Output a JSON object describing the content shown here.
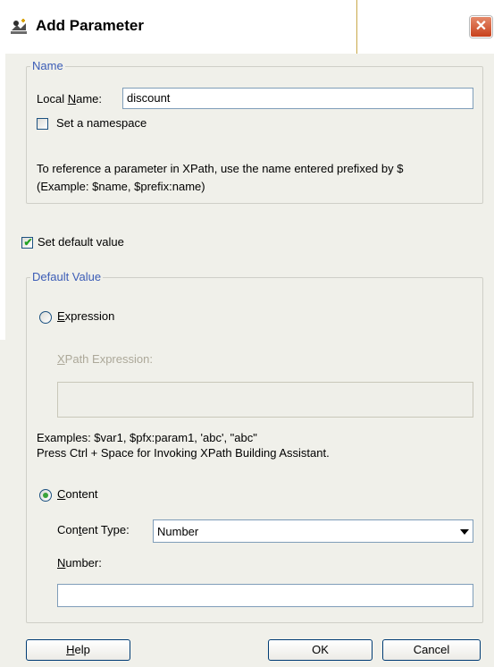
{
  "window": {
    "title": "Add Parameter",
    "close_glyph": "✕"
  },
  "name_group": {
    "legend": "Name",
    "local_name_label_prefix": "Local ",
    "local_name_label_key": "N",
    "local_name_label_suffix": "ame:",
    "local_name_value": "discount",
    "namespace_checkbox_label": "Set a namespace",
    "namespace_checked": false,
    "hint_line1": "To reference a parameter in XPath, use the name entered prefixed by $",
    "hint_line2": "(Example: $name, $prefix:name)"
  },
  "default_checkbox": {
    "label": "Set default value",
    "checked": true
  },
  "default_group": {
    "legend": "Default Value",
    "expression_radio_key": "E",
    "expression_radio_rest": "xpression",
    "expression_selected": false,
    "xpath_label_key": "X",
    "xpath_label_rest": "Path Expression:",
    "xpath_value": "",
    "examples_line1": "Examples: $var1, $pfx:param1, 'abc', \"abc\"",
    "examples_line2": "Press Ctrl + Space for Invoking XPath Building Assistant.",
    "content_radio_key": "C",
    "content_radio_rest": "ontent",
    "content_selected": true,
    "content_type_label_prefix": "Con",
    "content_type_label_key": "t",
    "content_type_label_suffix": "ent Type:",
    "content_type_value": "Number",
    "number_label_key": "N",
    "number_label_rest": "umber:",
    "number_value": ""
  },
  "buttons": {
    "help_key": "H",
    "help_rest": "elp",
    "ok": "OK",
    "cancel": "Cancel"
  },
  "icons": {
    "title_icon": "add-parameter-icon",
    "close_icon": "close-icon",
    "dropdown_icon": "chevron-down-icon"
  },
  "colors": {
    "legend_blue": "#3b5cb6",
    "close_red": "#c8411c",
    "check_green": "#21a121"
  }
}
